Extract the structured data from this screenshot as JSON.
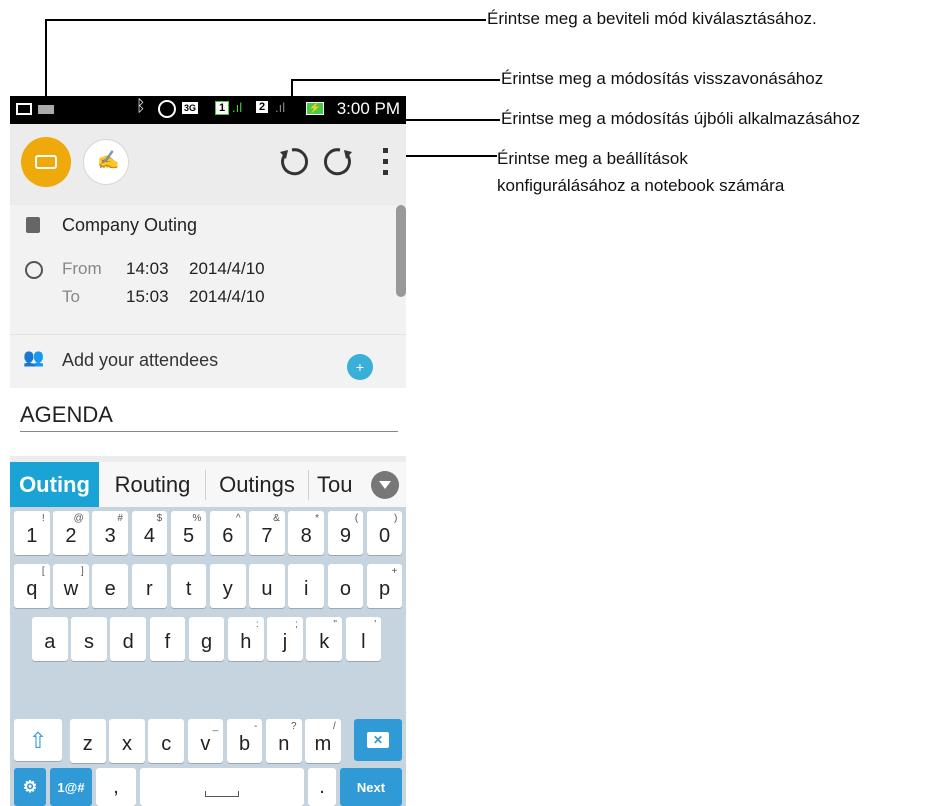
{
  "callouts": {
    "input_mode": "Érintse meg a beviteli mód kiválasztásához.",
    "undo": "Érintse meg a módosítás visszavonásához",
    "redo": "Érintse meg a módosítás újbóli alkalmazásához",
    "settings_line1": "Érintse meg a beállítások",
    "settings_line2": "konfigurálásához a notebook számára"
  },
  "status_bar": {
    "time": "3:00 PM",
    "network": "3G",
    "sim1": "1",
    "sim2": "2"
  },
  "event": {
    "title": "Company Outing",
    "from_label": "From",
    "from_time": "14:03",
    "from_date": "2014/4/10",
    "to_label": "To",
    "to_time": "15:03",
    "to_date": "2014/4/10",
    "attendees_placeholder": "Add your attendees"
  },
  "note": {
    "text": "AGENDA"
  },
  "suggestions": [
    "Outing",
    "Routing",
    "Outings",
    "Tou"
  ],
  "keyboard": {
    "row1": [
      [
        "1",
        "!"
      ],
      [
        "2",
        "@"
      ],
      [
        "3",
        "#"
      ],
      [
        "4",
        "$"
      ],
      [
        "5",
        "%"
      ],
      [
        "6",
        "^"
      ],
      [
        "7",
        "&"
      ],
      [
        "8",
        "*"
      ],
      [
        "9",
        "("
      ],
      [
        "0",
        ")"
      ]
    ],
    "row2": [
      [
        "q",
        "["
      ],
      [
        "w",
        "]"
      ],
      [
        "e",
        ""
      ],
      [
        "r",
        ""
      ],
      [
        "t",
        ""
      ],
      [
        "y",
        ""
      ],
      [
        "u",
        ""
      ],
      [
        "i",
        ""
      ],
      [
        "o",
        ""
      ],
      [
        "p",
        "+"
      ]
    ],
    "row3": [
      [
        "a",
        ""
      ],
      [
        "s",
        ""
      ],
      [
        "d",
        ""
      ],
      [
        "f",
        ""
      ],
      [
        "g",
        ""
      ],
      [
        "h",
        ":"
      ],
      [
        "j",
        ";"
      ],
      [
        "k",
        "\""
      ],
      [
        "l",
        "'"
      ]
    ],
    "row4": [
      [
        "z",
        ""
      ],
      [
        "x",
        ""
      ],
      [
        "c",
        ""
      ],
      [
        "v",
        "_"
      ],
      [
        "b",
        "-"
      ],
      [
        "n",
        "?"
      ],
      [
        "m",
        "/"
      ]
    ],
    "symbols_label": "1@#",
    "comma": ",",
    "period": ".",
    "next_label": "Next"
  },
  "colors": {
    "accent_orange": "#f0a90a",
    "keyboard_blue": "#2f9ad6",
    "keyboard_bg": "#c5d4df",
    "suggestion_highlight": "#1aa4d6"
  }
}
